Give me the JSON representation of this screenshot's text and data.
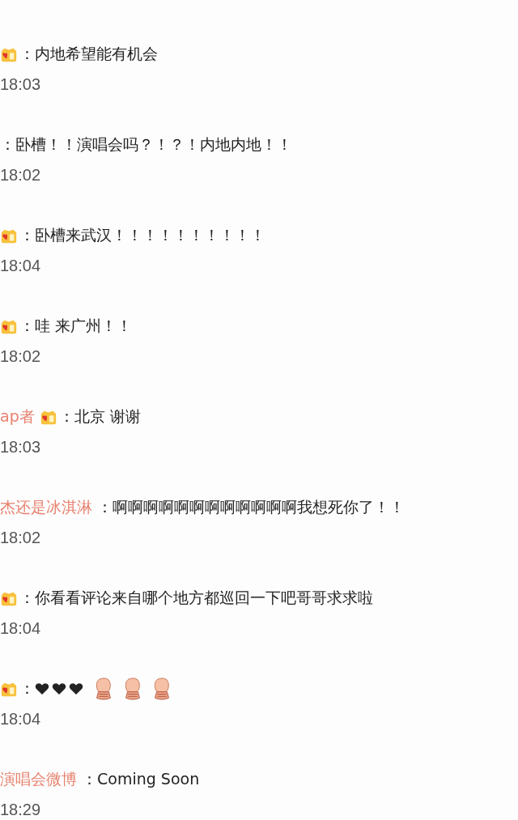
{
  "comments": [
    {
      "badge": true,
      "text": "：内地希望能有机会",
      "time": "18:03"
    },
    {
      "badge": false,
      "text": "：卧槽！！演唱会吗？！？！内地内地！！",
      "time": "18:02"
    },
    {
      "badge": true,
      "text": "：卧槽来武汉！！！！！！！！！！",
      "time": "18:04"
    },
    {
      "badge": true,
      "text": "：哇 来广州！！",
      "time": "18:02"
    },
    {
      "user": "ap者",
      "badge": true,
      "text": "：北京 谢谢",
      "time": "18:03"
    },
    {
      "user": "杰还是冰淇淋",
      "badge": false,
      "text": "：啊啊啊啊啊啊啊啊啊啊啊啊我想死你了！！",
      "time": "18:02"
    },
    {
      "badge": true,
      "text": "：你看看评论来自哪个地方都巡回一下吧哥哥求求啦",
      "time": "18:04"
    },
    {
      "badge": true,
      "text": "：",
      "emojis": [
        {
          "kind": "heart"
        },
        {
          "kind": "heart"
        },
        {
          "kind": "heart"
        },
        {
          "kind": "bow"
        },
        {
          "kind": "bow"
        },
        {
          "kind": "bow"
        }
      ],
      "time": "18:04"
    },
    {
      "user": "演唱会微博",
      "badge": false,
      "text": "：Coming Soon",
      "time": "18:29"
    }
  ]
}
